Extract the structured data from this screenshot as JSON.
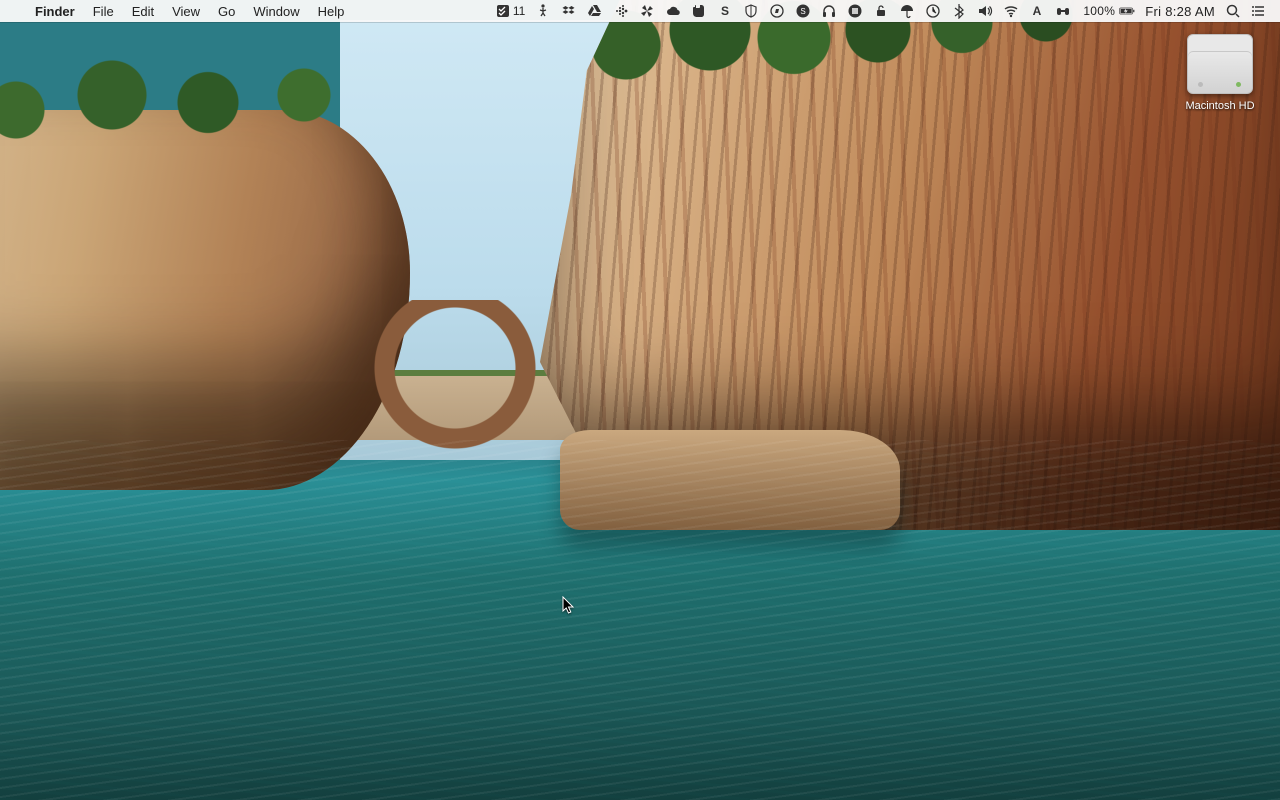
{
  "menubar": {
    "app_name": "Finder",
    "items": [
      "File",
      "Edit",
      "View",
      "Go",
      "Window",
      "Help"
    ]
  },
  "status": {
    "todoist_count": "11",
    "battery_pct": "100%",
    "clock": "Fri 8:28 AM"
  },
  "desktop": {
    "drive_label": "Macintosh HD"
  }
}
